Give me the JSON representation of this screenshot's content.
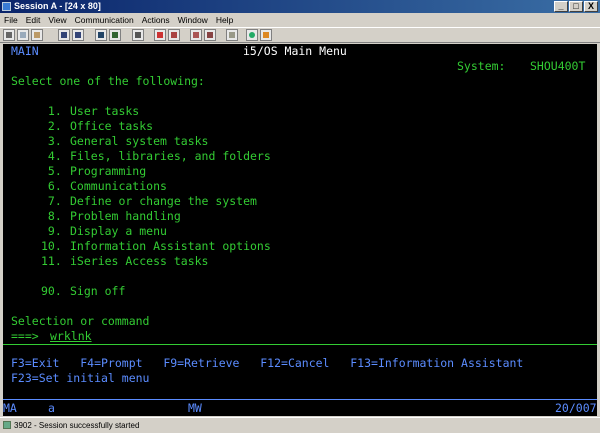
{
  "window": {
    "title": "Session A - [24 x 80]",
    "controls": {
      "minimize": "_",
      "maximize": "□",
      "close": "X"
    }
  },
  "menubar": {
    "items": [
      "File",
      "Edit",
      "View",
      "Communication",
      "Actions",
      "Window",
      "Help"
    ]
  },
  "toolbar": {
    "buttons": [
      "print-screen-icon",
      "copy-icon",
      "paste-icon",
      "send-icon",
      "receive-icon",
      "display-icon",
      "color-icon",
      "keyboard-icon",
      "stop-icon",
      "record-macro-icon",
      "play-macro-icon",
      "macro-icon",
      "clipboard-icon",
      "map-icon",
      "help-icon"
    ]
  },
  "screen": {
    "menu_id": "MAIN",
    "title": "i5/OS Main Menu",
    "system_label": "System:",
    "system_name": "SHOU400T",
    "prompt": "Select one of the following:",
    "options": [
      {
        "num": " 1.",
        "label": "User tasks"
      },
      {
        "num": " 2.",
        "label": "Office tasks"
      },
      {
        "num": " 3.",
        "label": "General system tasks"
      },
      {
        "num": " 4.",
        "label": "Files, libraries, and folders"
      },
      {
        "num": " 5.",
        "label": "Programming"
      },
      {
        "num": " 6.",
        "label": "Communications"
      },
      {
        "num": " 7.",
        "label": "Define or change the system"
      },
      {
        "num": " 8.",
        "label": "Problem handling"
      },
      {
        "num": " 9.",
        "label": "Display a menu"
      },
      {
        "num": "10.",
        "label": "Information Assistant options"
      },
      {
        "num": "11.",
        "label": "iSeries Access tasks"
      }
    ],
    "signoff": {
      "num": "90.",
      "label": "Sign off"
    },
    "selection_label": "Selection or command",
    "command_prompt": "===>",
    "command_value": "wrklnk",
    "fkeys_line1": "F3=Exit   F4=Prompt   F9=Retrieve   F12=Cancel   F13=Information Assistant",
    "fkeys_line2": "F23=Set initial menu"
  },
  "oia": {
    "left": "MA",
    "indicator": "a",
    "mode": "MW",
    "cursor_pos": "20/007"
  },
  "statusbar": {
    "text": "3902 - Session successfully started"
  },
  "colors": {
    "screen_bg": "#000000",
    "field_green": "#33cc33",
    "info_blue": "#5b8cff",
    "input_white": "#ffffff"
  }
}
